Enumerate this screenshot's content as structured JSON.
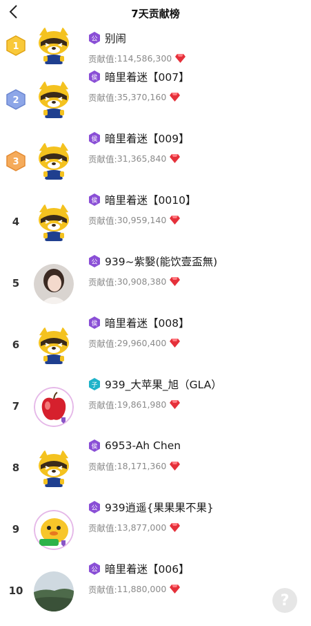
{
  "header": {
    "title": "7天贡献榜"
  },
  "score_prefix": "贡献值: ",
  "colors": {
    "gem": "#e5303a",
    "tag_purple": "#8a4fd6",
    "tag_cyan": "#1fb3c9"
  },
  "rows": [
    {
      "rank": "1",
      "badge": "gold",
      "avatar": "raccoon",
      "tag": "公",
      "tag_color": "purple",
      "name": "别闹",
      "score": "114,586,300"
    },
    {
      "rank": "2",
      "badge": "silver",
      "avatar": "raccoon",
      "tag": "侯",
      "tag_color": "purple",
      "name": "暗里着迷【007】",
      "score": "35,370,160"
    },
    {
      "rank": "3",
      "badge": "bronze",
      "avatar": "raccoon",
      "tag": "侯",
      "tag_color": "purple",
      "name": "暗里着迷【009】",
      "score": "31,365,840"
    },
    {
      "rank": "4",
      "badge": "",
      "avatar": "raccoon",
      "tag": "侯",
      "tag_color": "purple",
      "name": "暗里着迷【0010】",
      "score": "30,959,140"
    },
    {
      "rank": "5",
      "badge": "",
      "avatar": "photo-woman",
      "tag": "公",
      "tag_color": "purple",
      "name": "939~紫嫛(能饮壹盃無)",
      "score": "30,908,380"
    },
    {
      "rank": "6",
      "badge": "",
      "avatar": "raccoon",
      "tag": "侯",
      "tag_color": "purple",
      "name": "暗里着迷【008】",
      "score": "29,960,400"
    },
    {
      "rank": "7",
      "badge": "",
      "avatar": "apple",
      "tag": "子",
      "tag_color": "cyan",
      "name": "939_大苹果_旭（GLA）",
      "score": "19,861,980"
    },
    {
      "rank": "8",
      "badge": "",
      "avatar": "raccoon",
      "tag": "侯",
      "tag_color": "purple",
      "name": "6953-Ah Chen",
      "score": "18,171,360"
    },
    {
      "rank": "9",
      "badge": "",
      "avatar": "cartoon-duck",
      "tag": "公",
      "tag_color": "purple",
      "name": "939逍遥{果果果不果}",
      "score": "13,877,000"
    },
    {
      "rank": "10",
      "badge": "",
      "avatar": "landscape",
      "tag": "公",
      "tag_color": "purple",
      "name": "暗里着迷【006】",
      "score": "11,880,000"
    }
  ],
  "help": {
    "label": "?"
  }
}
